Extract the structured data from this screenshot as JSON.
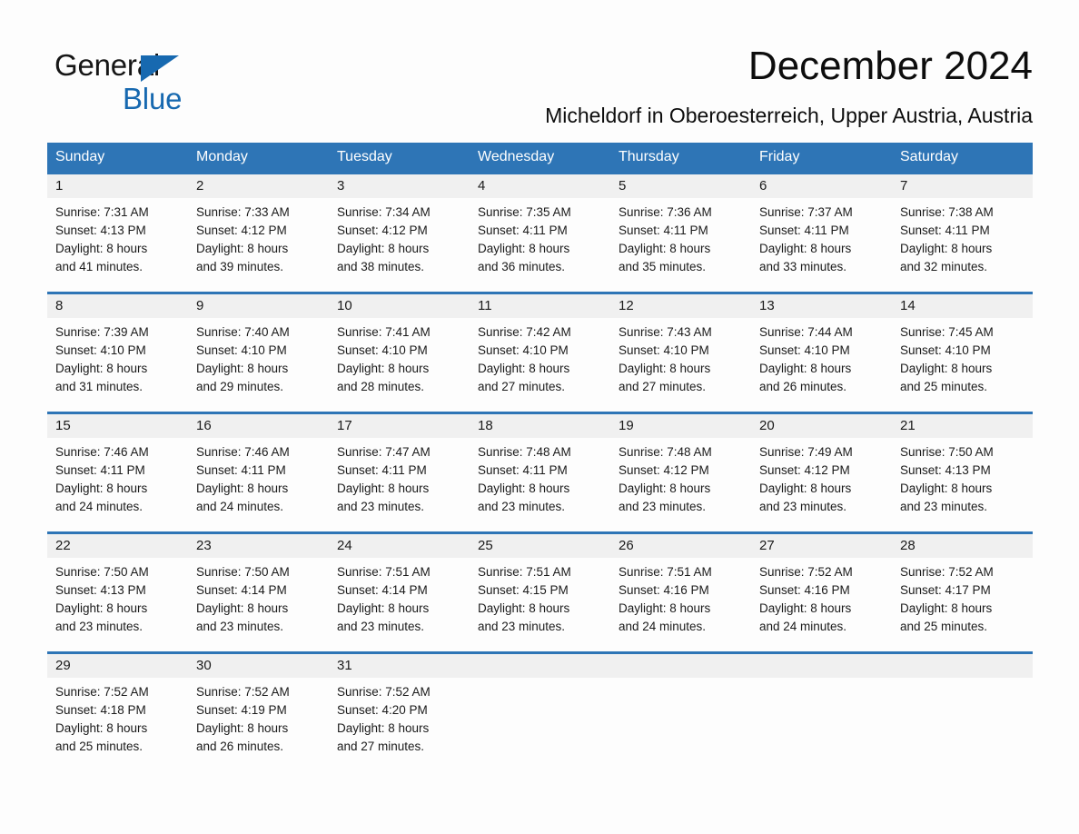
{
  "brand": {
    "name_dark": "General",
    "name_blue": "Blue",
    "triangle_color": "#1769b0"
  },
  "header": {
    "title": "December 2024",
    "subtitle": "Micheldorf in Oberoesterreich, Upper Austria, Austria"
  },
  "theme": {
    "header_blue": "#2e75b6",
    "band_gray": "#f0f0f0",
    "text_dark": "#1a1a1a",
    "page_bg": "#fdfdfd"
  },
  "calendar": {
    "weekdays": [
      "Sunday",
      "Monday",
      "Tuesday",
      "Wednesday",
      "Thursday",
      "Friday",
      "Saturday"
    ],
    "weeks": [
      [
        {
          "day": "1",
          "sunrise": "Sunrise: 7:31 AM",
          "sunset": "Sunset: 4:13 PM",
          "daylight_1": "Daylight: 8 hours",
          "daylight_2": "and 41 minutes."
        },
        {
          "day": "2",
          "sunrise": "Sunrise: 7:33 AM",
          "sunset": "Sunset: 4:12 PM",
          "daylight_1": "Daylight: 8 hours",
          "daylight_2": "and 39 minutes."
        },
        {
          "day": "3",
          "sunrise": "Sunrise: 7:34 AM",
          "sunset": "Sunset: 4:12 PM",
          "daylight_1": "Daylight: 8 hours",
          "daylight_2": "and 38 minutes."
        },
        {
          "day": "4",
          "sunrise": "Sunrise: 7:35 AM",
          "sunset": "Sunset: 4:11 PM",
          "daylight_1": "Daylight: 8 hours",
          "daylight_2": "and 36 minutes."
        },
        {
          "day": "5",
          "sunrise": "Sunrise: 7:36 AM",
          "sunset": "Sunset: 4:11 PM",
          "daylight_1": "Daylight: 8 hours",
          "daylight_2": "and 35 minutes."
        },
        {
          "day": "6",
          "sunrise": "Sunrise: 7:37 AM",
          "sunset": "Sunset: 4:11 PM",
          "daylight_1": "Daylight: 8 hours",
          "daylight_2": "and 33 minutes."
        },
        {
          "day": "7",
          "sunrise": "Sunrise: 7:38 AM",
          "sunset": "Sunset: 4:11 PM",
          "daylight_1": "Daylight: 8 hours",
          "daylight_2": "and 32 minutes."
        }
      ],
      [
        {
          "day": "8",
          "sunrise": "Sunrise: 7:39 AM",
          "sunset": "Sunset: 4:10 PM",
          "daylight_1": "Daylight: 8 hours",
          "daylight_2": "and 31 minutes."
        },
        {
          "day": "9",
          "sunrise": "Sunrise: 7:40 AM",
          "sunset": "Sunset: 4:10 PM",
          "daylight_1": "Daylight: 8 hours",
          "daylight_2": "and 29 minutes."
        },
        {
          "day": "10",
          "sunrise": "Sunrise: 7:41 AM",
          "sunset": "Sunset: 4:10 PM",
          "daylight_1": "Daylight: 8 hours",
          "daylight_2": "and 28 minutes."
        },
        {
          "day": "11",
          "sunrise": "Sunrise: 7:42 AM",
          "sunset": "Sunset: 4:10 PM",
          "daylight_1": "Daylight: 8 hours",
          "daylight_2": "and 27 minutes."
        },
        {
          "day": "12",
          "sunrise": "Sunrise: 7:43 AM",
          "sunset": "Sunset: 4:10 PM",
          "daylight_1": "Daylight: 8 hours",
          "daylight_2": "and 27 minutes."
        },
        {
          "day": "13",
          "sunrise": "Sunrise: 7:44 AM",
          "sunset": "Sunset: 4:10 PM",
          "daylight_1": "Daylight: 8 hours",
          "daylight_2": "and 26 minutes."
        },
        {
          "day": "14",
          "sunrise": "Sunrise: 7:45 AM",
          "sunset": "Sunset: 4:10 PM",
          "daylight_1": "Daylight: 8 hours",
          "daylight_2": "and 25 minutes."
        }
      ],
      [
        {
          "day": "15",
          "sunrise": "Sunrise: 7:46 AM",
          "sunset": "Sunset: 4:11 PM",
          "daylight_1": "Daylight: 8 hours",
          "daylight_2": "and 24 minutes."
        },
        {
          "day": "16",
          "sunrise": "Sunrise: 7:46 AM",
          "sunset": "Sunset: 4:11 PM",
          "daylight_1": "Daylight: 8 hours",
          "daylight_2": "and 24 minutes."
        },
        {
          "day": "17",
          "sunrise": "Sunrise: 7:47 AM",
          "sunset": "Sunset: 4:11 PM",
          "daylight_1": "Daylight: 8 hours",
          "daylight_2": "and 23 minutes."
        },
        {
          "day": "18",
          "sunrise": "Sunrise: 7:48 AM",
          "sunset": "Sunset: 4:11 PM",
          "daylight_1": "Daylight: 8 hours",
          "daylight_2": "and 23 minutes."
        },
        {
          "day": "19",
          "sunrise": "Sunrise: 7:48 AM",
          "sunset": "Sunset: 4:12 PM",
          "daylight_1": "Daylight: 8 hours",
          "daylight_2": "and 23 minutes."
        },
        {
          "day": "20",
          "sunrise": "Sunrise: 7:49 AM",
          "sunset": "Sunset: 4:12 PM",
          "daylight_1": "Daylight: 8 hours",
          "daylight_2": "and 23 minutes."
        },
        {
          "day": "21",
          "sunrise": "Sunrise: 7:50 AM",
          "sunset": "Sunset: 4:13 PM",
          "daylight_1": "Daylight: 8 hours",
          "daylight_2": "and 23 minutes."
        }
      ],
      [
        {
          "day": "22",
          "sunrise": "Sunrise: 7:50 AM",
          "sunset": "Sunset: 4:13 PM",
          "daylight_1": "Daylight: 8 hours",
          "daylight_2": "and 23 minutes."
        },
        {
          "day": "23",
          "sunrise": "Sunrise: 7:50 AM",
          "sunset": "Sunset: 4:14 PM",
          "daylight_1": "Daylight: 8 hours",
          "daylight_2": "and 23 minutes."
        },
        {
          "day": "24",
          "sunrise": "Sunrise: 7:51 AM",
          "sunset": "Sunset: 4:14 PM",
          "daylight_1": "Daylight: 8 hours",
          "daylight_2": "and 23 minutes."
        },
        {
          "day": "25",
          "sunrise": "Sunrise: 7:51 AM",
          "sunset": "Sunset: 4:15 PM",
          "daylight_1": "Daylight: 8 hours",
          "daylight_2": "and 23 minutes."
        },
        {
          "day": "26",
          "sunrise": "Sunrise: 7:51 AM",
          "sunset": "Sunset: 4:16 PM",
          "daylight_1": "Daylight: 8 hours",
          "daylight_2": "and 24 minutes."
        },
        {
          "day": "27",
          "sunrise": "Sunrise: 7:52 AM",
          "sunset": "Sunset: 4:16 PM",
          "daylight_1": "Daylight: 8 hours",
          "daylight_2": "and 24 minutes."
        },
        {
          "day": "28",
          "sunrise": "Sunrise: 7:52 AM",
          "sunset": "Sunset: 4:17 PM",
          "daylight_1": "Daylight: 8 hours",
          "daylight_2": "and 25 minutes."
        }
      ],
      [
        {
          "day": "29",
          "sunrise": "Sunrise: 7:52 AM",
          "sunset": "Sunset: 4:18 PM",
          "daylight_1": "Daylight: 8 hours",
          "daylight_2": "and 25 minutes."
        },
        {
          "day": "30",
          "sunrise": "Sunrise: 7:52 AM",
          "sunset": "Sunset: 4:19 PM",
          "daylight_1": "Daylight: 8 hours",
          "daylight_2": "and 26 minutes."
        },
        {
          "day": "31",
          "sunrise": "Sunrise: 7:52 AM",
          "sunset": "Sunset: 4:20 PM",
          "daylight_1": "Daylight: 8 hours",
          "daylight_2": "and 27 minutes."
        },
        {
          "day": "",
          "sunrise": "",
          "sunset": "",
          "daylight_1": "",
          "daylight_2": ""
        },
        {
          "day": "",
          "sunrise": "",
          "sunset": "",
          "daylight_1": "",
          "daylight_2": ""
        },
        {
          "day": "",
          "sunrise": "",
          "sunset": "",
          "daylight_1": "",
          "daylight_2": ""
        },
        {
          "day": "",
          "sunrise": "",
          "sunset": "",
          "daylight_1": "",
          "daylight_2": ""
        }
      ]
    ]
  }
}
